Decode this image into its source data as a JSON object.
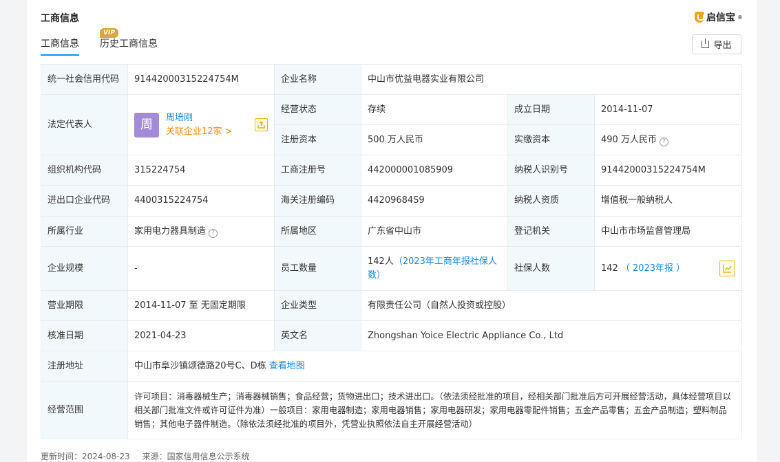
{
  "header": {
    "title": "工商信息",
    "brand": "启信宝",
    "brand_mark": "®"
  },
  "tabs": {
    "basic": "工商信息",
    "history": "历史工商信息",
    "vip": "VIP"
  },
  "export_label": "导出",
  "rows": {
    "credit_code_label": "统一社会信用代码",
    "credit_code": "91442000315224754M",
    "company_name_label": "企业名称",
    "company_name": "中山市优益电器实业有限公司",
    "legal_rep_label": "法定代表人",
    "legal_rep_avatar": "周",
    "legal_rep_name": "周培刚",
    "legal_rep_related": "关联企业12家 >",
    "status_label": "经营状态",
    "status": "存续",
    "founded_label": "成立日期",
    "founded": "2014-11-07",
    "reg_capital_label": "注册资本",
    "reg_capital": "500 万人民币",
    "paid_capital_label": "实缴资本",
    "paid_capital": "490 万人民币",
    "org_code_label": "组织机构代码",
    "org_code": "315224754",
    "biz_reg_no_label": "工商注册号",
    "biz_reg_no": "442000001085909",
    "taxpayer_id_label": "纳税人识别号",
    "taxpayer_id": "91442000315224754M",
    "import_export_label": "进出口企业代码",
    "import_export": "4400315224754",
    "customs_label": "海关注册编码",
    "customs": "44209684S9",
    "taxpayer_qual_label": "纳税人资质",
    "taxpayer_qual": "增值税一般纳税人",
    "industry_label": "所属行业",
    "industry": "家用电力器具制造",
    "region_label": "所属地区",
    "region": "广东省中山市",
    "authority_label": "登记机关",
    "authority": "中山市市场监督管理局",
    "scale_label": "企业规模",
    "scale": "-",
    "employees_label": "员工数量",
    "employees_value": "142人",
    "employees_link": "（2023年工商年报社保人数）",
    "social_label": "社保人数",
    "social_value": "142",
    "social_link": "（ 2023年报 ）",
    "term_label": "营业期限",
    "term": "2014-11-07 至 无固定期限",
    "type_label": "企业类型",
    "type": "有限责任公司（自然人投资或控股）",
    "approval_label": "核准日期",
    "approval": "2021-04-23",
    "english_label": "英文名",
    "english": "Zhongshan Yoice Electric Appliance Co., Ltd",
    "address_label": "注册地址",
    "address": "中山市阜沙镇颂德路20号C、D栋",
    "map_link": "查看地图",
    "scope_label": "经营范围",
    "scope": "许可项目：消毒器械生产；消毒器械销售；食品经营；货物进出口；技术进出口。（依法须经批准的项目，经相关部门批准后方可开展经营活动，具体经营项目以相关部门批准文件或许可证件为准）一般项目：家用电器制造；家用电器销售；家用电器研发；家用电器零配件销售；五金产品零售；五金产品制造；塑料制品销售；其他电子器件制造。（除依法须经批准的项目外，凭营业执照依法自主开展经营活动）"
  },
  "footer": {
    "update": "更新时间：2024-08-23",
    "source": "来源：国家信用信息公示系统"
  }
}
